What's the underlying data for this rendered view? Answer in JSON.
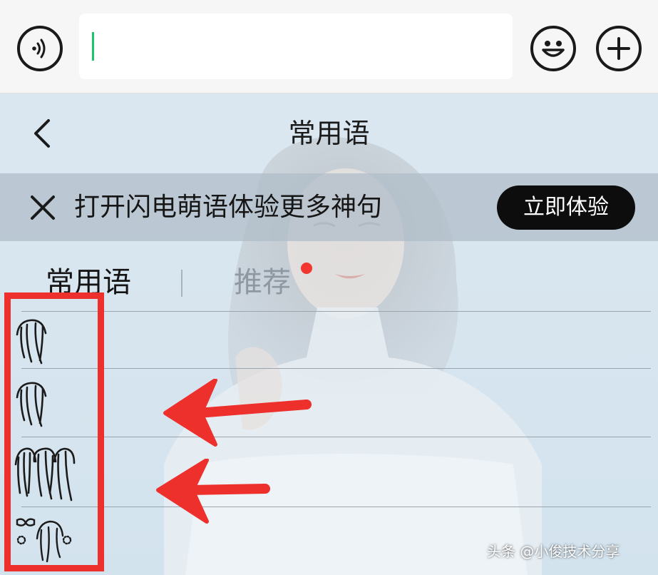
{
  "input_bar": {
    "voice_icon": "voice-waves-icon",
    "emoji_icon": "smiley-icon",
    "plus_icon": "plus-circle-icon",
    "caret_color": "#1ec36b"
  },
  "header": {
    "title": "常用语",
    "back_icon": "chevron-left-icon"
  },
  "banner": {
    "text": "打开闪电萌语体验更多神句",
    "button_label": "立即体验",
    "close_icon": "close-x-icon"
  },
  "tabs": [
    {
      "label": "常用语",
      "active": true
    },
    {
      "label": "推荐",
      "active": false,
      "badge_color": "#f1372f"
    }
  ],
  "phrases": [
    {
      "icon": "single-strand-hair-icon"
    },
    {
      "icon": "single-strand-hair-icon"
    },
    {
      "icon": "triple-strand-hair-icon"
    },
    {
      "icon": "bow-and-hair-icon"
    }
  ],
  "annotation": {
    "box_color": "#ee302d",
    "arrow_color": "#ee302d"
  },
  "watermark": "头条 @小俊技术分享"
}
